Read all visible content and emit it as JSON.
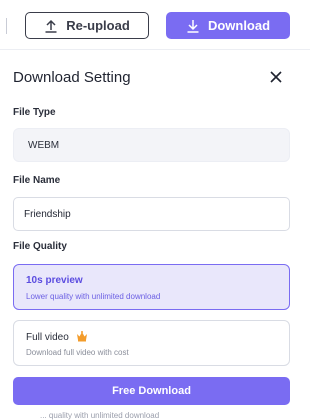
{
  "toolbar": {
    "reupload_label": "Re-upload",
    "download_label": "Download"
  },
  "panel": {
    "title": "Download Setting",
    "close_icon": "close-icon"
  },
  "file_type": {
    "label": "File Type",
    "value": "WEBM"
  },
  "file_name": {
    "label": "File Name",
    "value": "Friendship"
  },
  "file_quality": {
    "label": "File Quality",
    "options": [
      {
        "title": "10s preview",
        "subtitle": "Lower quality with unlimited download",
        "selected": true
      },
      {
        "title": "Full video",
        "subtitle": "Download full video with cost",
        "selected": false,
        "icon": "crown-icon"
      }
    ]
  },
  "action": {
    "free_download_label": "Free Download",
    "footer_text_cut": "... quality with unlimited download"
  },
  "colors": {
    "accent": "#7a6cf2",
    "accent_light": "#e9e7fb",
    "crown": "#f39c2b"
  }
}
